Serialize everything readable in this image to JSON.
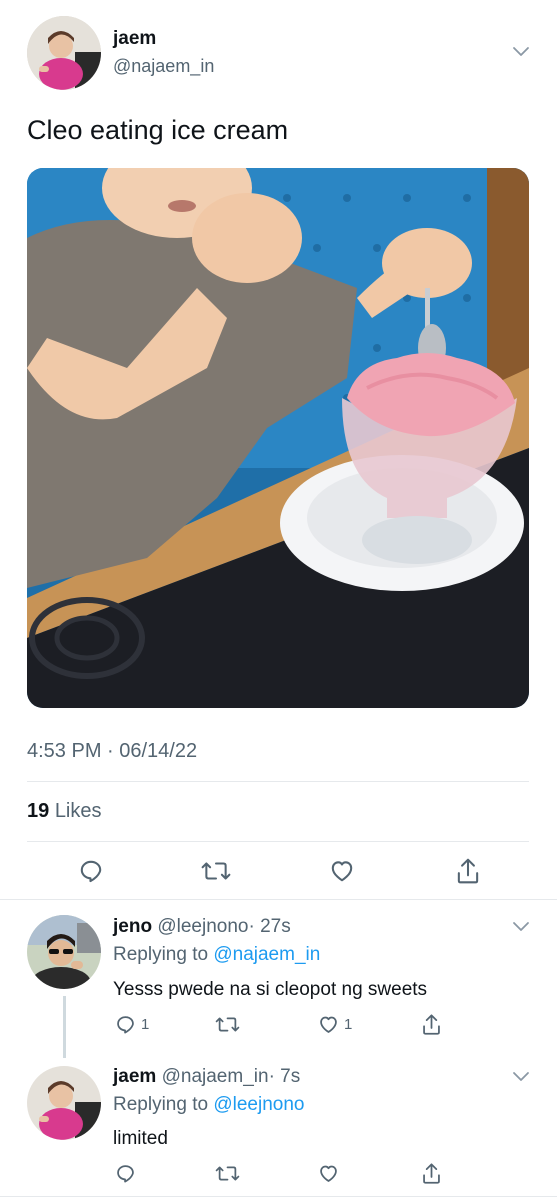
{
  "main_tweet": {
    "display_name": "jaem",
    "handle": "@najaem_in",
    "text": "Cleo eating ice cream",
    "timestamp": "4:53 PM · 06/14/22",
    "likes_count": "19",
    "likes_label": "Likes"
  },
  "replies": [
    {
      "display_name": "jeno",
      "handle": "@leejnono",
      "time": "· 27s",
      "replying_label": "Replying to",
      "replying_to": "@najaem_in",
      "text": "Yesss pwede na si cleopot ng sweets",
      "reply_count": "1",
      "like_count": "1"
    },
    {
      "display_name": "jaem",
      "handle": "@najaem_in",
      "time": "· 7s",
      "replying_label": "Replying to",
      "replying_to": "@leejnono",
      "text": "limited"
    }
  ],
  "icons": {
    "reply": "reply-icon",
    "retweet": "retweet-icon",
    "like": "heart-icon",
    "share": "share-icon",
    "more": "chevron-down-icon"
  },
  "colors": {
    "link": "#1d9bf0",
    "muted": "#536471",
    "divider": "#e6e9ec"
  }
}
